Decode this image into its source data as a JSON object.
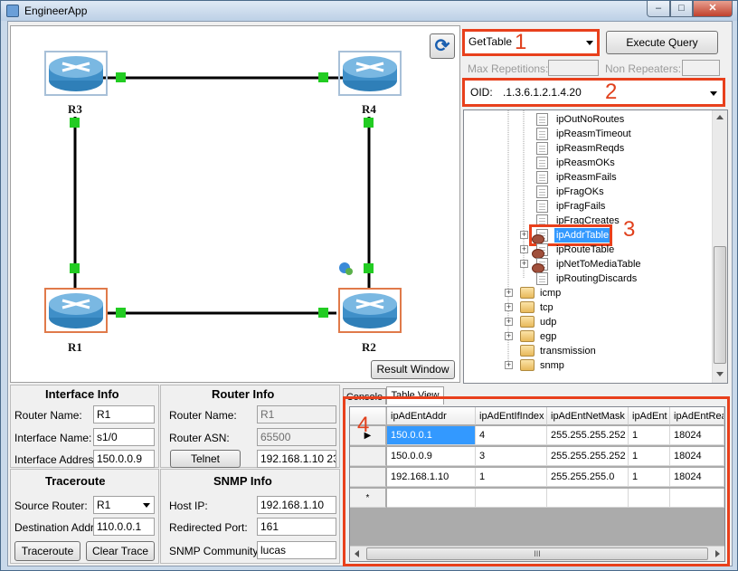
{
  "window": {
    "title": "EngineerApp"
  },
  "network": {
    "routers": [
      {
        "label": "R3"
      },
      {
        "label": "R4"
      },
      {
        "label": "R1"
      },
      {
        "label": "R2"
      }
    ],
    "refresh_icon": "refresh-icon",
    "result_window_label": "Result Window"
  },
  "query": {
    "operation": "GetTable",
    "execute_label": "Execute Query",
    "max_repetitions_label": "Max Repetitions:",
    "non_repeaters_label": "Non Repeaters:",
    "oid_label": "OID:",
    "oid_value": ".1.3.6.1.2.1.4.20"
  },
  "mib_tree": {
    "items": [
      {
        "label": "ipOutNoRoutes",
        "type": "leaf"
      },
      {
        "label": "ipReasmTimeout",
        "type": "leaf"
      },
      {
        "label": "ipReasmReqds",
        "type": "leaf"
      },
      {
        "label": "ipReasmOKs",
        "type": "leaf"
      },
      {
        "label": "ipReasmFails",
        "type": "leaf"
      },
      {
        "label": "ipFragOKs",
        "type": "leaf"
      },
      {
        "label": "ipFragFails",
        "type": "leaf"
      },
      {
        "label": "ipFragCreates",
        "type": "leaf"
      },
      {
        "label": "ipAddrTable",
        "type": "table",
        "selected": true
      },
      {
        "label": "ipRouteTable",
        "type": "table"
      },
      {
        "label": "ipNetToMediaTable",
        "type": "table"
      },
      {
        "label": "ipRoutingDiscards",
        "type": "leaf"
      },
      {
        "label": "icmp",
        "type": "folder"
      },
      {
        "label": "tcp",
        "type": "folder"
      },
      {
        "label": "udp",
        "type": "folder"
      },
      {
        "label": "egp",
        "type": "folder"
      },
      {
        "label": "transmission",
        "type": "folder"
      },
      {
        "label": "snmp",
        "type": "folder"
      }
    ]
  },
  "interface_info": {
    "title": "Interface Info",
    "router_name_label": "Router Name:",
    "router_name": "R1",
    "interface_name_label": "Interface Name:",
    "interface_name": "s1/0",
    "interface_address_label": "Interface Address:",
    "interface_address": "150.0.0.9"
  },
  "router_info": {
    "title": "Router Info",
    "router_name_label": "Router Name:",
    "router_name": "R1",
    "router_asn_label": "Router ASN:",
    "router_asn": "65500",
    "telnet_label": "Telnet",
    "telnet_address": "192.168.1.10 23"
  },
  "traceroute": {
    "title": "Traceroute",
    "source_router_label": "Source Router:",
    "source_router": "R1",
    "destination_label": "Destination Addr:",
    "destination": "110.0.0.1",
    "traceroute_label": "Traceroute",
    "clear_trace_label": "Clear Trace"
  },
  "snmp_info": {
    "title": "SNMP Info",
    "host_ip_label": "Host IP:",
    "host_ip": "192.168.1.10",
    "redirected_port_label": "Redirected Port:",
    "redirected_port": "161",
    "community_label": "SNMP Community:",
    "community": "lucas"
  },
  "results": {
    "tabs": [
      "Console",
      "Table View"
    ],
    "columns": [
      "ipAdEntAddr",
      "ipAdEntIfIndex",
      "ipAdEntNetMask",
      "ipAdEnt",
      "ipAdEntRea"
    ],
    "rows": [
      [
        "150.0.0.1",
        "4",
        "255.255.255.252",
        "1",
        "18024"
      ],
      [
        "150.0.0.9",
        "3",
        "255.255.255.252",
        "1",
        "18024"
      ],
      [
        "192.168.1.10",
        "1",
        "255.255.255.0",
        "1",
        "18024"
      ]
    ],
    "current_row_marker": "▶",
    "new_row_marker": "*",
    "scroll_grip": "III"
  },
  "annotations": [
    "1",
    "2",
    "3",
    "4"
  ],
  "colors": {
    "annotation": "#e8401c",
    "link_port": "#22cc22",
    "selection": "#3399ff"
  }
}
